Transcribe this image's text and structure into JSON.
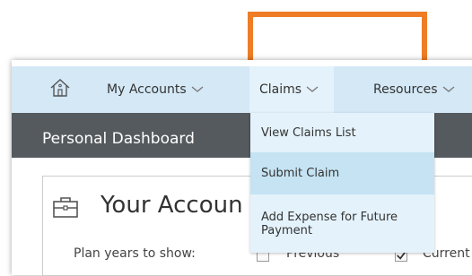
{
  "nav": {
    "items": [
      {
        "label": "My Accounts"
      },
      {
        "label": "Claims"
      },
      {
        "label": "Resources"
      }
    ]
  },
  "dropdown": {
    "items": [
      {
        "label": "View Claims List"
      },
      {
        "label": "Submit Claim"
      },
      {
        "label": "Add Expense for Future Payment"
      }
    ]
  },
  "dashboard": {
    "title": "Personal Dashboard"
  },
  "card": {
    "title": "Your Accoun",
    "plan_years_label": "Plan years to show:",
    "options": [
      {
        "label": "Previous",
        "checked": false
      },
      {
        "label": "Current",
        "checked": true
      }
    ]
  },
  "colors": {
    "highlight": "#ee7d25",
    "nav_bg": "#d4e8f6",
    "dropdown_bg": "#e4f2fb",
    "dropdown_selected": "#c5e3f2",
    "dashboard_bar": "#555a5e"
  },
  "icons": {
    "home": "home-icon",
    "chevron": "chevron-down-icon",
    "briefcase": "briefcase-icon",
    "check": "check-icon"
  }
}
